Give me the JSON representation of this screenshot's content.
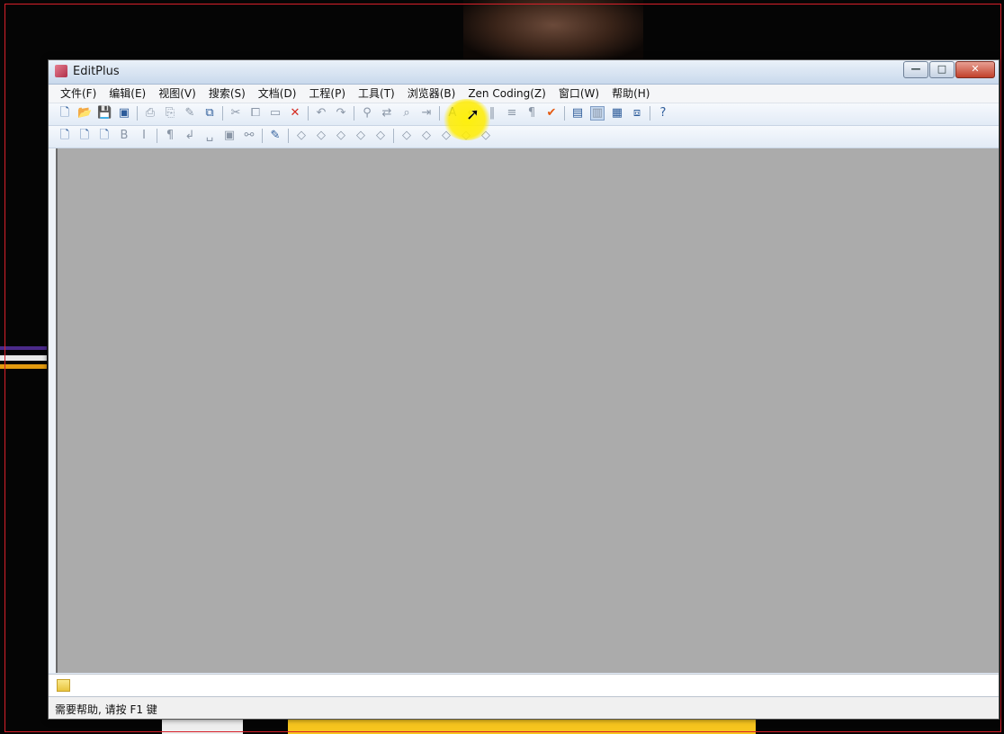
{
  "window": {
    "title": "EditPlus",
    "controls": {
      "minimize": "—",
      "maximize": "□",
      "close": "✕"
    }
  },
  "menu": {
    "items": [
      "文件(F)",
      "编辑(E)",
      "视图(V)",
      "搜索(S)",
      "文档(D)",
      "工程(P)",
      "工具(T)",
      "浏览器(B)",
      "Zen Coding(Z)",
      "窗口(W)",
      "帮助(H)"
    ]
  },
  "toolbar1": {
    "icons": [
      {
        "name": "new-file-icon",
        "glyph": "🗋",
        "state": "on"
      },
      {
        "name": "open-folder-icon",
        "glyph": "📂",
        "state": "on"
      },
      {
        "name": "save-icon",
        "glyph": "💾",
        "state": "off"
      },
      {
        "name": "save-all-icon",
        "glyph": "▣",
        "state": "on"
      },
      {
        "sep": true
      },
      {
        "name": "print-icon",
        "glyph": "⎙",
        "state": "off"
      },
      {
        "name": "print-preview-icon",
        "glyph": "⎘",
        "state": "off"
      },
      {
        "name": "spell-check-icon",
        "glyph": "✎",
        "state": "off"
      },
      {
        "name": "browser-preview-icon",
        "glyph": "⧉",
        "state": "on"
      },
      {
        "sep": true
      },
      {
        "name": "cut-icon",
        "glyph": "✂",
        "state": "off"
      },
      {
        "name": "copy-icon",
        "glyph": "⧠",
        "state": "off"
      },
      {
        "name": "paste-icon",
        "glyph": "▭",
        "state": "off"
      },
      {
        "name": "delete-icon",
        "glyph": "✕",
        "state": "red"
      },
      {
        "sep": true
      },
      {
        "name": "undo-icon",
        "glyph": "↶",
        "state": "off"
      },
      {
        "name": "redo-icon",
        "glyph": "↷",
        "state": "off"
      },
      {
        "sep": true
      },
      {
        "name": "find-icon",
        "glyph": "⚲",
        "state": "off"
      },
      {
        "name": "replace-icon",
        "glyph": "⇄",
        "state": "off"
      },
      {
        "name": "find-in-files-icon",
        "glyph": "⌕",
        "state": "off"
      },
      {
        "name": "goto-icon",
        "glyph": "⇥",
        "state": "off"
      },
      {
        "sep": true
      },
      {
        "name": "font-icon",
        "glyph": "A",
        "state": "on"
      },
      {
        "name": "word-wrap-icon",
        "glyph": "↵",
        "state": "off"
      },
      {
        "name": "ruler-icon",
        "glyph": "‖",
        "state": "off"
      },
      {
        "name": "line-number-icon",
        "glyph": "≡",
        "state": "off"
      },
      {
        "name": "whitespace-icon",
        "glyph": "¶",
        "state": "off"
      },
      {
        "name": "check-icon",
        "glyph": "✔",
        "state": "chk"
      },
      {
        "sep": true
      },
      {
        "name": "directory-window-icon",
        "glyph": "▤",
        "state": "on"
      },
      {
        "name": "output-window-icon",
        "glyph": "▥",
        "state": "pressed"
      },
      {
        "name": "cliptext-icon",
        "glyph": "▦",
        "state": "on"
      },
      {
        "name": "fullscreen-icon",
        "glyph": "⧈",
        "state": "on"
      },
      {
        "sep": true
      },
      {
        "name": "help-icon",
        "glyph": "?",
        "state": "on"
      }
    ]
  },
  "toolbar2": {
    "icons": [
      {
        "name": "new-html-icon",
        "glyph": "🗋",
        "state": "on"
      },
      {
        "name": "new-css-icon",
        "glyph": "🗋",
        "state": "on"
      },
      {
        "name": "new-js-icon",
        "glyph": "🗋",
        "state": "on"
      },
      {
        "name": "bold-icon",
        "glyph": "B",
        "state": "off"
      },
      {
        "name": "italic-icon",
        "glyph": "I",
        "state": "off"
      },
      {
        "sep": true
      },
      {
        "name": "paragraph-icon",
        "glyph": "¶",
        "state": "off"
      },
      {
        "name": "break-icon",
        "glyph": "↲",
        "state": "off"
      },
      {
        "name": "space-icon",
        "glyph": "␣",
        "state": "off"
      },
      {
        "name": "image-icon",
        "glyph": "▣",
        "state": "off"
      },
      {
        "name": "link-icon",
        "glyph": "⚯",
        "state": "off"
      },
      {
        "sep": true
      },
      {
        "name": "html-toolbar-icon",
        "glyph": "✎",
        "state": "on"
      },
      {
        "sep": true
      },
      {
        "name": "tag1-icon",
        "glyph": "◇",
        "state": "off"
      },
      {
        "name": "tag2-icon",
        "glyph": "◇",
        "state": "off"
      },
      {
        "name": "tag3-icon",
        "glyph": "◇",
        "state": "off"
      },
      {
        "name": "tag4-icon",
        "glyph": "◇",
        "state": "off"
      },
      {
        "name": "tag5-icon",
        "glyph": "◇",
        "state": "off"
      },
      {
        "sep": true
      },
      {
        "name": "tag6-icon",
        "glyph": "◇",
        "state": "off"
      },
      {
        "name": "tag7-icon",
        "glyph": "◇",
        "state": "off"
      },
      {
        "name": "tag8-icon",
        "glyph": "◇",
        "state": "off"
      },
      {
        "name": "tag9-icon",
        "glyph": "◇",
        "state": "off"
      },
      {
        "name": "tag10-icon",
        "glyph": "◇",
        "state": "off"
      }
    ]
  },
  "status": {
    "text": "需要帮助, 请按 F1 键"
  },
  "colors": {
    "workspace": "#ababab",
    "highlight": "#ffee00"
  }
}
